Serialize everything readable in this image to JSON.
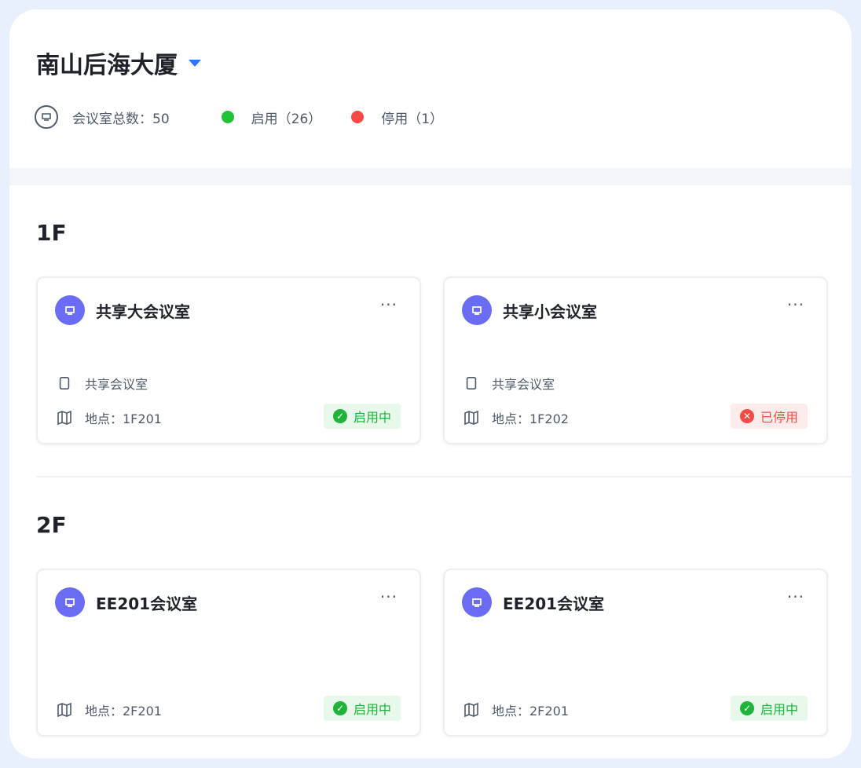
{
  "building": {
    "name": "南山后海大厦"
  },
  "stats": {
    "total_label": "会议室总数：50",
    "enabled_label": "启用（26）",
    "disabled_label": "停用（1）",
    "colors": {
      "enabled": "#1fc337",
      "disabled": "#f54a45"
    }
  },
  "floors": [
    {
      "title": "1F",
      "rooms": [
        {
          "name": "共享大会议室",
          "type": "共享会议室",
          "location": "地点：1F201",
          "status": "启用中",
          "status_kind": "enabled"
        },
        {
          "name": "共享小会议室",
          "type": "共享会议室",
          "location": "地点：1F202",
          "status": "已停用",
          "status_kind": "disabled"
        }
      ]
    },
    {
      "title": "2F",
      "rooms": [
        {
          "name": "EE201会议室",
          "location": "地点：2F201",
          "status": "启用中",
          "status_kind": "enabled"
        },
        {
          "name": "EE201会议室",
          "location": "地点：2F201",
          "status": "启用中",
          "status_kind": "enabled"
        }
      ]
    }
  ],
  "icons": {
    "dropdown": "caret-down-icon",
    "room": "meeting-room-icon",
    "type": "document-icon",
    "location": "map-icon",
    "more": "more-icon",
    "status_enabled": "check-circle-icon",
    "status_disabled": "close-circle-icon"
  },
  "more_label": "···"
}
